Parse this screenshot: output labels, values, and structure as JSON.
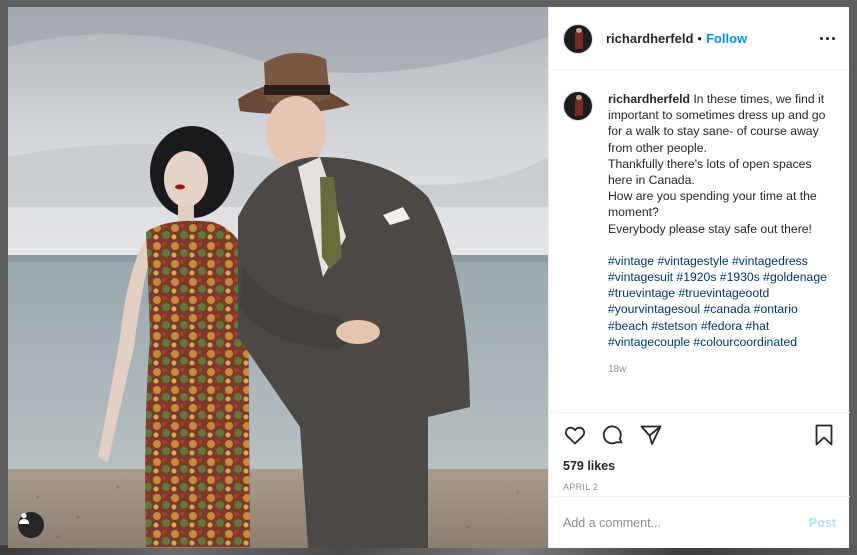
{
  "post": {
    "username": "richardherfeld",
    "follow_label": "Follow",
    "dot": "•",
    "caption_username": "richardherfeld",
    "caption_text": "In these times, we find it important to sometimes dress up and go for a walk to stay sane- of course away from other people.\nThankfully there's lots of open spaces here in Canada.\nHow are you spending your time at the moment?\nEverybody please stay safe out there!",
    "hashtags": "#vintage #vintagestyle #vintagedress #vintagesuit #1920s #1930s #goldenage #truevintage #truevintageootd #yourvintagesoul #canada #ontario #beach #stetson #fedora #hat #vintagecouple #colourcoordinated",
    "age": "18w",
    "likes": "579 likes",
    "date": "APRIL 2",
    "comment_placeholder": "Add a comment...",
    "post_label": "Post"
  },
  "icons": {
    "more": "more-options-icon",
    "like": "heart-icon",
    "comment": "comment-bubble-icon",
    "share": "share-paper-plane-icon",
    "save": "bookmark-icon",
    "tag": "user-tag-icon"
  },
  "colors": {
    "link_blue": "#0095f6",
    "hashtag_blue": "#00376b",
    "muted": "#8e8e8e",
    "post_disabled": "#b2dffc"
  }
}
